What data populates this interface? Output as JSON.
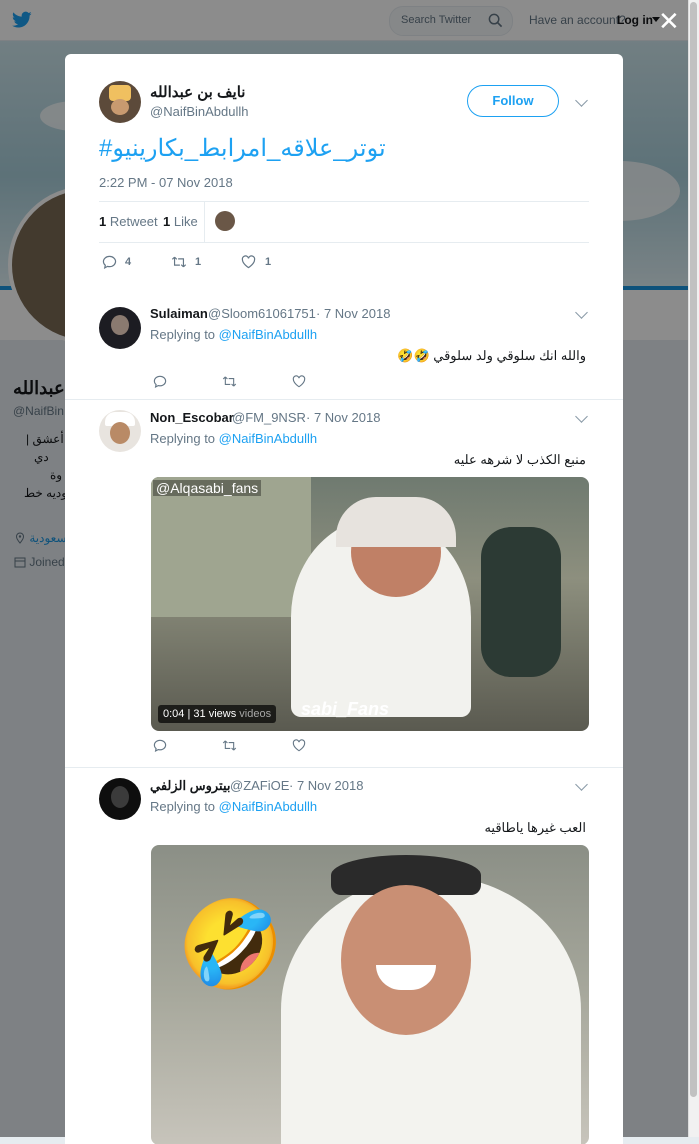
{
  "topbar": {
    "search_placeholder": "Search Twitter",
    "have_account": "Have an account?",
    "login": "Log in"
  },
  "profile": {
    "name": "عبدالله",
    "handle": "@NaifBin",
    "bio_lines": [
      "| أعشق",
      "دي",
      "وة",
      "وديه خط"
    ],
    "location": "السعودية",
    "joined": "Joined"
  },
  "tweet": {
    "author_name": "نايف بن عبدالله",
    "author_handle": "@NaifBinAbdullh",
    "follow_label": "Follow",
    "text": "#توتر_علاقه_امرابط_بكارينيو",
    "timestamp": "2:22 PM - 07 Nov 2018",
    "retweets_count": "1",
    "retweets_label": "Retweet",
    "likes_count": "1",
    "likes_label": "Like",
    "actions": {
      "replies": "4",
      "retweets": "1",
      "likes": "1"
    }
  },
  "replies": [
    {
      "name": "Sulaiman",
      "handle": "@Sloom61061751",
      "date": "· 7 Nov 2018",
      "replying_to_prefix": "Replying to",
      "replying_to": "@NaifBinAbdullh",
      "text": "والله انك سلوقي ولد سلوقي 🤣🤣"
    },
    {
      "name": "Non_Escobar",
      "handle": "@FM_9NSR",
      "date": "· 7 Nov 2018",
      "replying_to_prefix": "Replying to",
      "replying_to": "@NaifBinAbdullh",
      "text": "منبع الكذب لا شرهه عليه",
      "media": {
        "watermark_top": "@Alqasabi_fans",
        "watermark_bottom": "sabi_Fans",
        "duration": "0:04",
        "views": "31 views",
        "source": "videos"
      }
    },
    {
      "name": "بيتروس الزلفي",
      "handle": "@ZAFiOE",
      "date": "· 7 Nov 2018",
      "replying_to_prefix": "Replying to",
      "replying_to": "@NaifBinAbdullh",
      "text": "العب غيرها ياطاقيه",
      "media": {
        "emoji": "🤣"
      }
    }
  ],
  "colors": {
    "accent": "#1da1f2",
    "banner_stripe": "#1b95e0",
    "text": "#14171a",
    "muted": "#657786"
  },
  "icons": [
    "twitter-bird-icon",
    "search-icon",
    "close-icon",
    "chevron-down-icon",
    "reply-icon",
    "retweet-icon",
    "like-icon",
    "location-icon",
    "calendar-icon"
  ]
}
